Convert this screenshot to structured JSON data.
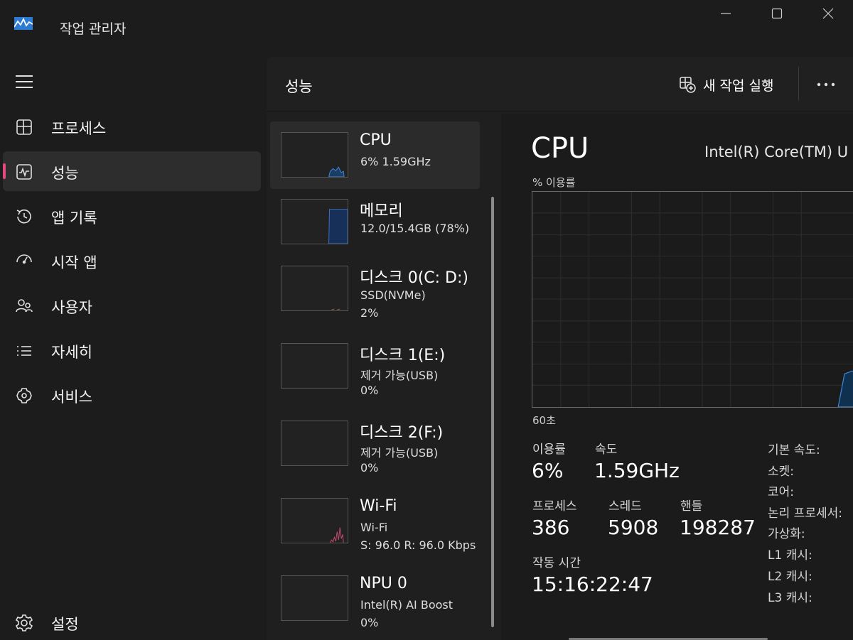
{
  "window": {
    "title": "작업 관리자",
    "controls": {
      "minimize_icon": "minimize-icon",
      "maximize_icon": "maximize-icon",
      "close_icon": "close-icon"
    }
  },
  "sidebar": {
    "items": [
      {
        "label": "프로세스",
        "icon": "processes-icon",
        "active": false
      },
      {
        "label": "성능",
        "icon": "performance-icon",
        "active": true
      },
      {
        "label": "앱 기록",
        "icon": "history-icon",
        "active": false
      },
      {
        "label": "시작 앱",
        "icon": "startup-icon",
        "active": false
      },
      {
        "label": "사용자",
        "icon": "users-icon",
        "active": false
      },
      {
        "label": "자세히",
        "icon": "details-icon",
        "active": false
      },
      {
        "label": "서비스",
        "icon": "services-icon",
        "active": false
      }
    ],
    "settings_label": "설정"
  },
  "header": {
    "title": "성능",
    "run_task_label": "새 작업 실행"
  },
  "devices": [
    {
      "name": "CPU",
      "sub": "6%  1.59GHz",
      "sub2": "",
      "selected": true
    },
    {
      "name": "메모리",
      "sub": "12.0/15.4GB (78%)",
      "sub2": "",
      "selected": false
    },
    {
      "name": "디스크 0(C: D:)",
      "sub": "SSD(NVMe)",
      "sub2": "2%",
      "selected": false
    },
    {
      "name": "디스크 1(E:)",
      "sub": "제거 가능(USB)",
      "sub2": "0%",
      "selected": false
    },
    {
      "name": "디스크 2(F:)",
      "sub": "제거 가능(USB)",
      "sub2": "0%",
      "selected": false
    },
    {
      "name": "Wi-Fi",
      "sub": "Wi-Fi",
      "sub2": "S: 96.0  R: 96.0 Kbps",
      "selected": false
    },
    {
      "name": "NPU 0",
      "sub": "Intel(R) AI Boost",
      "sub2": "0%",
      "selected": false
    }
  ],
  "detail": {
    "title": "CPU",
    "model": "Intel(R) Core(TM) U",
    "util_axis_label": "% 이용률",
    "time_axis_label": "60초",
    "stats": {
      "utilization_label": "이용률",
      "utilization_value": "6%",
      "speed_label": "속도",
      "speed_value": "1.59GHz",
      "processes_label": "프로세스",
      "processes_value": "386",
      "threads_label": "스레드",
      "threads_value": "5908",
      "handles_label": "핸들",
      "handles_value": "198287",
      "uptime_label": "작동 시간",
      "uptime_value": "15:16:22:47"
    },
    "specs": [
      "기본 속도:",
      "소켓:",
      "코어:",
      "논리 프로세서:",
      "가상화:",
      "L1 캐시:",
      "L2 캐시:",
      "L3 캐시:"
    ]
  },
  "colors": {
    "accent_indicator": "#e7487f",
    "cpu_graph": "#1a6ab8",
    "memory_graph": "#1d4f94",
    "wifi_graph": "#c24a6b",
    "disk_graph": "#8a6b3a"
  }
}
